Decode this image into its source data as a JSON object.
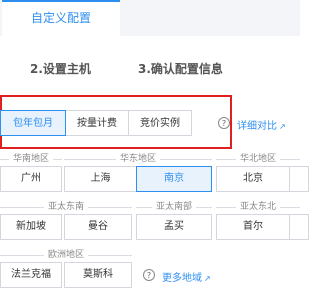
{
  "tabs": {
    "active": "自定义配置"
  },
  "steps": {
    "step2": "2.设置主机",
    "step3": "3.确认配置信息"
  },
  "billing": {
    "options": [
      "包年包月",
      "按量计费",
      "竞价实例"
    ],
    "selected": "包年包月",
    "help": "?",
    "compare_link": "详细对比",
    "external_icon": "↗"
  },
  "regions": {
    "groups": [
      "华南地区",
      "华东地区",
      "华北地区",
      "亚太东南",
      "亚太南部",
      "亚太东北",
      "欧洲地区"
    ],
    "cities": [
      "广州",
      "上海",
      "南京",
      "北京",
      "新加坡",
      "曼谷",
      "孟买",
      "首尔",
      "法兰克福",
      "莫斯科"
    ],
    "selected": "南京",
    "help": "?",
    "more_link": "更多地域",
    "external_icon": "↗"
  },
  "colors": {
    "accent": "#2f8ff0",
    "highlight_box": "#e02020",
    "selected_bg": "#e8f2fd"
  }
}
